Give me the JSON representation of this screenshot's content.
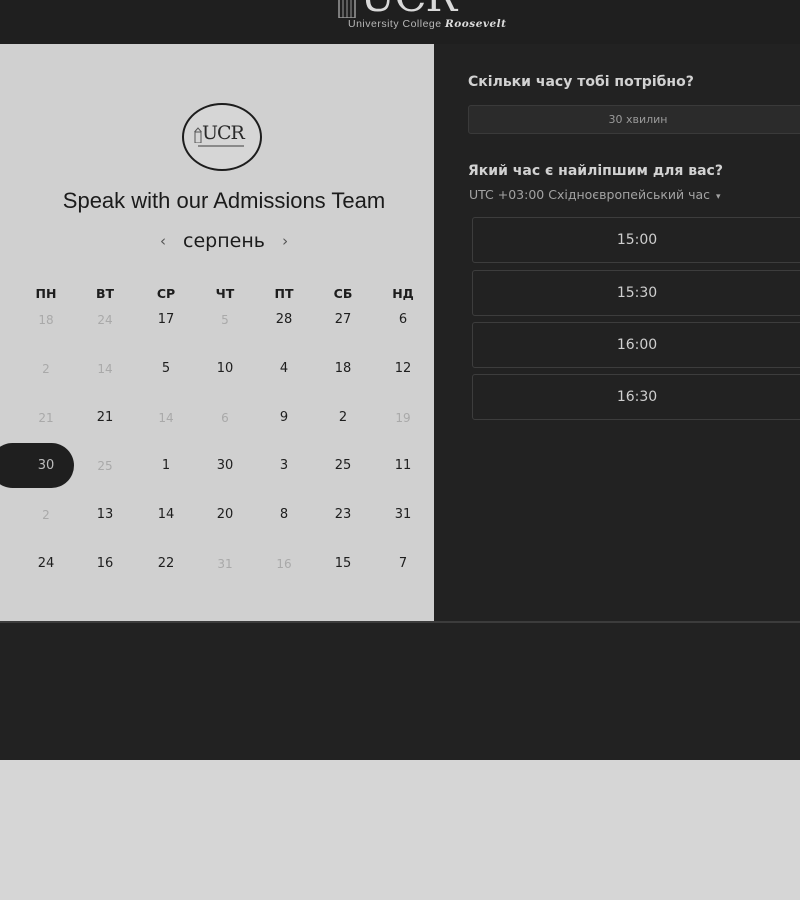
{
  "header": {
    "brand_letters": "UCR",
    "brand_tagline": "University College",
    "brand_tagline_em": "Roosevelt"
  },
  "left_panel": {
    "logo_text": "UCR",
    "title": "Speak with our Admissions Team",
    "month": "серпень",
    "prev_icon": "‹",
    "next_icon": "›",
    "weekdays": [
      "ПН",
      "ВТ",
      "СР",
      "ЧТ",
      "ПТ",
      "СБ",
      "НД"
    ],
    "weeks": [
      [
        {
          "d": "18",
          "m": true
        },
        {
          "d": "24",
          "m": true
        },
        {
          "d": "17"
        },
        {
          "d": "5",
          "m": true
        },
        {
          "d": "28"
        },
        {
          "d": "27"
        },
        {
          "d": "6"
        }
      ],
      [
        {
          "d": "2",
          "m": true
        },
        {
          "d": "14",
          "m": true
        },
        {
          "d": "5"
        },
        {
          "d": "10"
        },
        {
          "d": "4"
        },
        {
          "d": "18"
        },
        {
          "d": "12"
        }
      ],
      [
        {
          "d": "21",
          "m": true
        },
        {
          "d": "21"
        },
        {
          "d": "14",
          "m": true
        },
        {
          "d": "6",
          "m": true
        },
        {
          "d": "9"
        },
        {
          "d": "2"
        },
        {
          "d": "19",
          "m": true
        }
      ],
      [
        {
          "d": "30",
          "s": true
        },
        {
          "d": "25",
          "m": true
        },
        {
          "d": "1"
        },
        {
          "d": "30"
        },
        {
          "d": "3"
        },
        {
          "d": "25"
        },
        {
          "d": "11"
        }
      ],
      [
        {
          "d": "2",
          "m": true
        },
        {
          "d": "13"
        },
        {
          "d": "14"
        },
        {
          "d": "20"
        },
        {
          "d": "8"
        },
        {
          "d": "23"
        },
        {
          "d": "31"
        }
      ],
      [
        {
          "d": "24"
        },
        {
          "d": "16"
        },
        {
          "d": "22"
        },
        {
          "d": "31",
          "m": true
        },
        {
          "d": "16",
          "m": true
        },
        {
          "d": "15"
        },
        {
          "d": "7"
        }
      ]
    ]
  },
  "right_panel": {
    "duration_question": "Скільки часу тобі потрібно?",
    "duration_value": "30 хвилин",
    "time_question": "Який час є найліпшим для вас?",
    "timezone": "UTC +03:00 Східноєвропейський час",
    "timezone_caret": "▾",
    "slots": [
      "15:00",
      "15:30",
      "16:00",
      "16:30"
    ]
  },
  "colors": {
    "dark": "#222222",
    "light_panel": "#d0d0d0",
    "page": "#d6d6d6"
  }
}
